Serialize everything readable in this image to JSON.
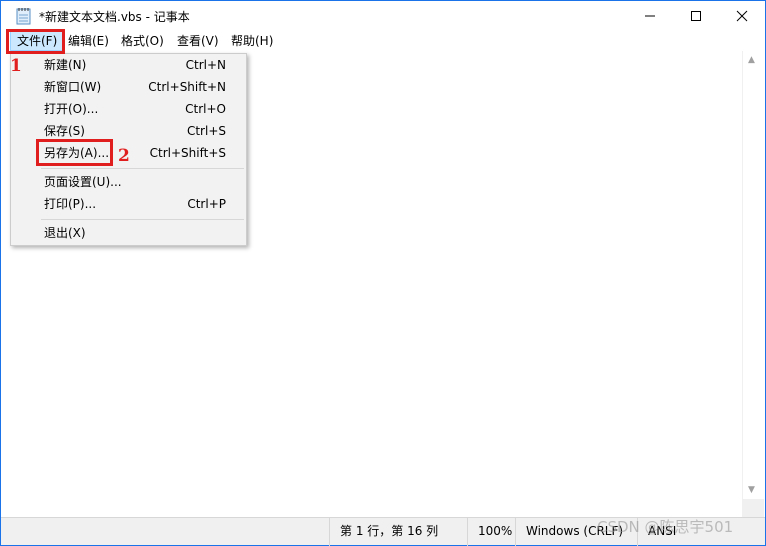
{
  "window": {
    "title": "*新建文本文档.vbs - 记事本"
  },
  "menubar": {
    "file": "文件(F)",
    "edit": "编辑(E)",
    "format": "格式(O)",
    "view": "查看(V)",
    "help": "帮助(H)"
  },
  "file_menu": {
    "items": [
      {
        "label": "新建(N)",
        "shortcut": "Ctrl+N"
      },
      {
        "label": "新窗口(W)",
        "shortcut": "Ctrl+Shift+N"
      },
      {
        "label": "打开(O)...",
        "shortcut": "Ctrl+O"
      },
      {
        "label": "保存(S)",
        "shortcut": "Ctrl+S"
      },
      {
        "label": "另存为(A)...",
        "shortcut": "Ctrl+Shift+S"
      },
      {
        "label": "页面设置(U)...",
        "shortcut": ""
      },
      {
        "label": "打印(P)...",
        "shortcut": "Ctrl+P"
      },
      {
        "label": "退出(X)",
        "shortcut": ""
      }
    ]
  },
  "callouts": {
    "one": "1",
    "two": "2"
  },
  "statusbar": {
    "position": "第 1 行，第 16 列",
    "zoom": "100%",
    "eol": "Windows (CRLF)",
    "encoding": "ANSI"
  },
  "watermark": "CSDN @陈思宇501",
  "colors": {
    "highlight": "#e01e1e",
    "menu_active_bg": "#cce8ff",
    "window_border": "#1a73e8"
  }
}
